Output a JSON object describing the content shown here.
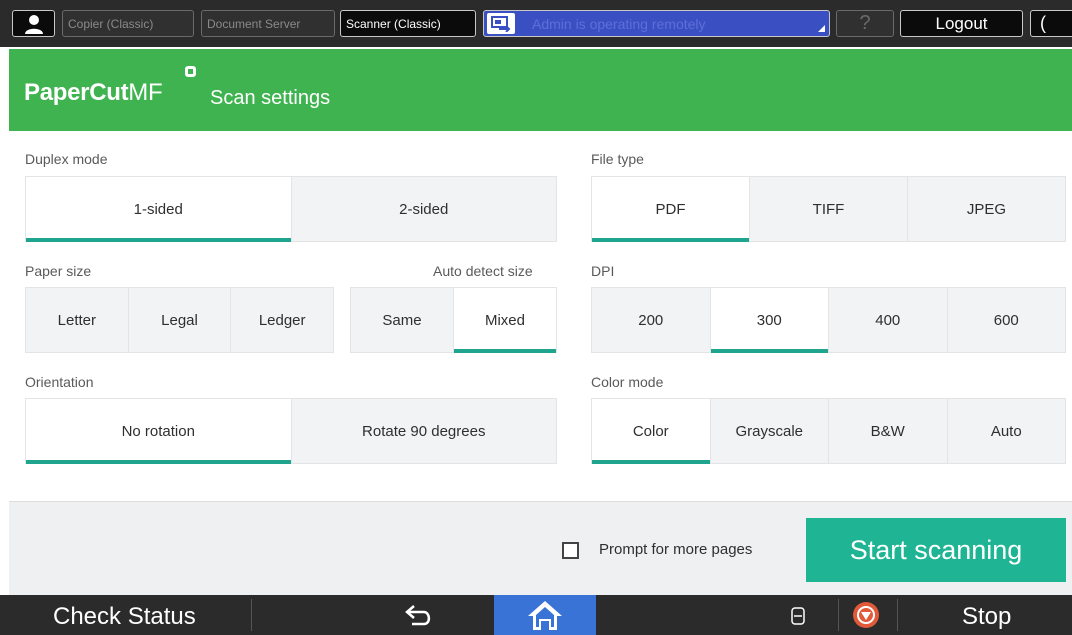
{
  "topbar": {
    "copier_label": "Copier (Classic)",
    "docserver_label": "Document Server",
    "scanner_label": "Scanner (Classic)",
    "remote_text": "Admin is operating remotely",
    "help_label": "?",
    "logout_label": "Logout",
    "moon_label": "("
  },
  "header": {
    "brand_main": "PaperCut",
    "brand_mf": "MF",
    "title": "Scan settings"
  },
  "sections": {
    "duplex": {
      "label": "Duplex mode",
      "options": [
        "1-sided",
        "2-sided"
      ],
      "selected": "1-sided"
    },
    "filetype": {
      "label": "File type",
      "options": [
        "PDF",
        "TIFF",
        "JPEG"
      ],
      "selected": "PDF"
    },
    "papersize": {
      "label": "Paper size",
      "options": [
        "Letter",
        "Legal",
        "Ledger"
      ],
      "selected": null
    },
    "autodetect": {
      "label": "Auto detect size",
      "options": [
        "Same",
        "Mixed"
      ],
      "selected": "Mixed"
    },
    "dpi": {
      "label": "DPI",
      "options": [
        "200",
        "300",
        "400",
        "600"
      ],
      "selected": "300"
    },
    "orientation": {
      "label": "Orientation",
      "options": [
        "No rotation",
        "Rotate 90 degrees"
      ],
      "selected": "No rotation"
    },
    "colormode": {
      "label": "Color mode",
      "options": [
        "Color",
        "Grayscale",
        "B&W",
        "Auto"
      ],
      "selected": "Color"
    }
  },
  "actions": {
    "prompt_label": "Prompt for more pages",
    "prompt_checked": false,
    "start_label": "Start scanning"
  },
  "sysbar": {
    "check_status_label": "Check Status",
    "stop_label": "Stop"
  },
  "colors": {
    "header_green": "#3fb34f",
    "accent_teal": "#1fa58d",
    "start_button": "#1fb594",
    "home_blue": "#3a73d6",
    "stop_red": "#e05a3a"
  }
}
